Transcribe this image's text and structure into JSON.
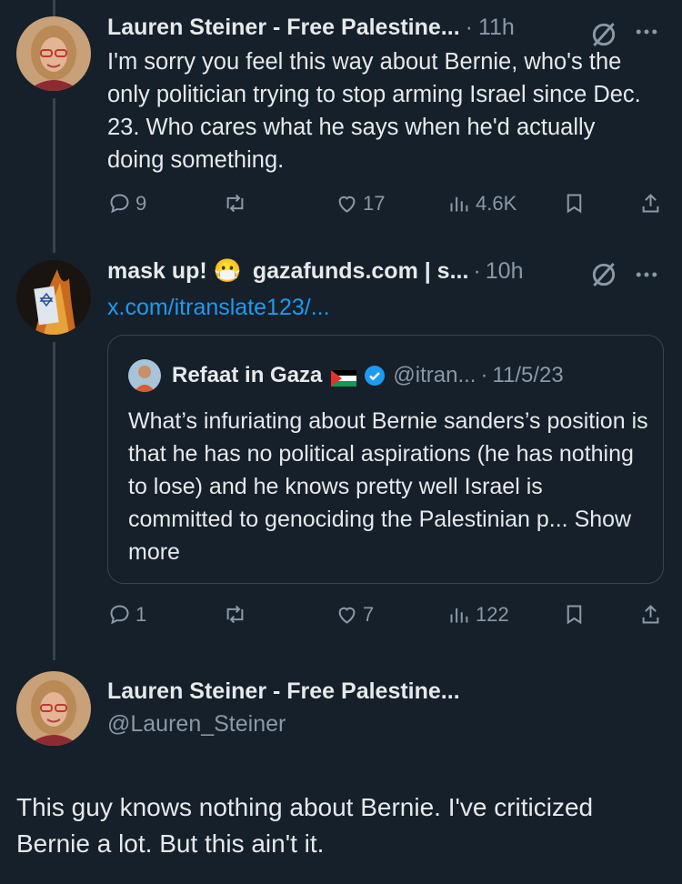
{
  "reply1": {
    "author_name": "Lauren Steiner - Free Palestine...",
    "separator": "·",
    "time": "11h",
    "text": "I'm sorry you feel this way about Bernie, who's the only politician trying to stop arming Israel since Dec. 23. Who cares what he says when he'd actually doing something.",
    "replies": "9",
    "reposts": "",
    "likes": "17",
    "views": "4.6K"
  },
  "reply2": {
    "author_name": "mask up! 😷",
    "author_name_extra": "gazafunds.com | s...",
    "separator": "·",
    "time": "10h",
    "link": "x.com/itranslate123/...",
    "quote": {
      "name": "Refaat in Gaza",
      "flag": "🇵🇸",
      "handle": "@itran...",
      "separator": "·",
      "date": "11/5/23",
      "text": "What’s infuriating about Bernie sanders’s position is that he has no political aspirations (he has nothing to lose) and he knows pretty well Israel is committed to genociding the Palestinian p...",
      "show_more": "Show more"
    },
    "replies": "1",
    "reposts": "",
    "likes": "7",
    "views": "122"
  },
  "main_post": {
    "author_name": "Lauren Steiner - Free Palestine...",
    "handle": "@Lauren_Steiner",
    "text": "This guy knows nothing about Bernie. I've criticized Bernie a lot. But this ain't it."
  },
  "colors": {
    "background": "#15202b",
    "text": "#e7e9ea",
    "muted": "#8b98a5",
    "link": "#1d9bf0",
    "verified": "#1d9bf0"
  },
  "icons": [
    "reply-icon",
    "repost-icon",
    "like-icon",
    "views-icon",
    "bookmark-icon",
    "share-icon",
    "grok-icon",
    "more-icon",
    "verified-icon"
  ]
}
